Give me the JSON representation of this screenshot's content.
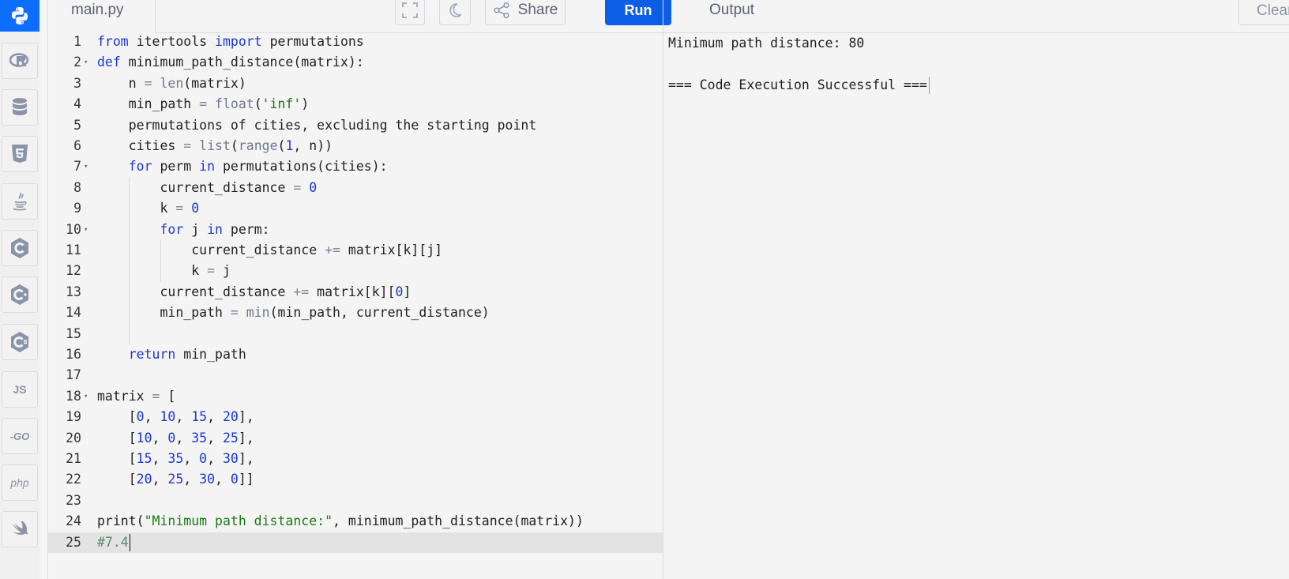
{
  "file_tab": {
    "label": "main.py"
  },
  "toolbar": {
    "share_label": "Share",
    "run_label": "Run"
  },
  "output_panel": {
    "title": "Output",
    "clear_label": "Clear",
    "lines": [
      "Minimum path distance: 80",
      "",
      "=== Code Execution Successful ==="
    ]
  },
  "languages": [
    {
      "name": "python",
      "icon": "python-icon",
      "active": true
    },
    {
      "name": "r",
      "icon": "r-icon",
      "active": false
    },
    {
      "name": "sql",
      "icon": "database-icon",
      "active": false
    },
    {
      "name": "html",
      "icon": "html5-icon",
      "active": false
    },
    {
      "name": "java",
      "icon": "java-icon",
      "active": false
    },
    {
      "name": "c",
      "icon": "c-icon",
      "active": false
    },
    {
      "name": "cpp",
      "icon": "cpp-icon",
      "active": false
    },
    {
      "name": "csharp",
      "icon": "csharp-icon",
      "active": false
    },
    {
      "name": "javascript",
      "icon": "js-icon",
      "label": "JS",
      "active": false
    },
    {
      "name": "go",
      "icon": "go-icon",
      "label": "GO",
      "active": false
    },
    {
      "name": "php",
      "icon": "php-icon",
      "label": "php",
      "active": false
    },
    {
      "name": "swift",
      "icon": "swift-icon",
      "active": false
    }
  ],
  "editor": {
    "current_line": 25,
    "lines": [
      {
        "n": "1",
        "text": "from itertools import permutations"
      },
      {
        "n": "2",
        "text": "def minimum_path_distance(matrix):"
      },
      {
        "n": "3",
        "text": "    n = len(matrix)"
      },
      {
        "n": "4",
        "text": "    min_path = float('inf')"
      },
      {
        "n": "5",
        "text": "    permutations of cities, excluding the starting point"
      },
      {
        "n": "6",
        "text": "    cities = list(range(1, n))"
      },
      {
        "n": "7",
        "text": "    for perm in permutations(cities):"
      },
      {
        "n": "8",
        "text": "        current_distance = 0"
      },
      {
        "n": "9",
        "text": "        k = 0"
      },
      {
        "n": "10",
        "text": "        for j in perm:"
      },
      {
        "n": "11",
        "text": "            current_distance += matrix[k][j]"
      },
      {
        "n": "12",
        "text": "            k = j"
      },
      {
        "n": "13",
        "text": "        current_distance += matrix[k][0]"
      },
      {
        "n": "14",
        "text": "        min_path = min(min_path, current_distance)"
      },
      {
        "n": "15",
        "text": ""
      },
      {
        "n": "16",
        "text": "    return min_path"
      },
      {
        "n": "17",
        "text": ""
      },
      {
        "n": "18",
        "text": "matrix = ["
      },
      {
        "n": "19",
        "text": "    [0, 10, 15, 20],"
      },
      {
        "n": "20",
        "text": "    [10, 0, 35, 25],"
      },
      {
        "n": "21",
        "text": "    [15, 35, 0, 30],"
      },
      {
        "n": "22",
        "text": "    [20, 25, 30, 0]]"
      },
      {
        "n": "23",
        "text": ""
      },
      {
        "n": "24",
        "text": "print(\"Minimum path distance:\", minimum_path_distance(matrix))"
      },
      {
        "n": "25",
        "text": "#7.4"
      }
    ]
  }
}
